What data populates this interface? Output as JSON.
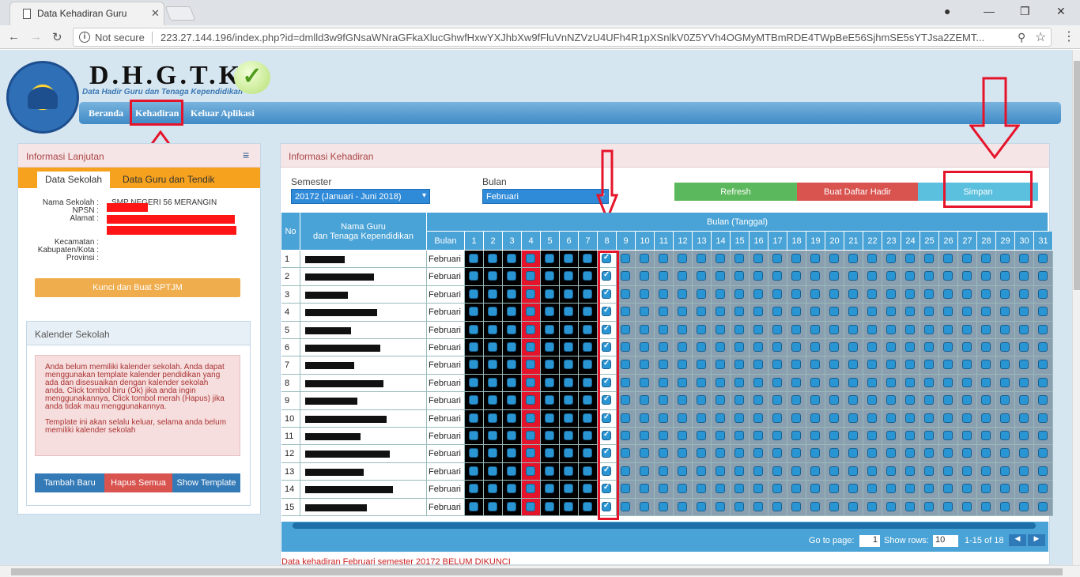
{
  "browser": {
    "tab_title": "Data Kehadiran Guru",
    "not_secure": "Not secure",
    "url": "223.27.144.196/index.php?id=dmlld3w9fGNsaWNraGFkaXlucGhwfHxwYXJhbXw9fFluVnNZVzU4UFh4R1pXSnlkV0Z5YVh4OGMyMTBmRDE4TWpBeE56SjhmSE5sYTJsa2ZEMT..."
  },
  "brand": {
    "title": "D.H.G.T.K",
    "tagline": "Data Hadir Guru dan Tenaga Kependidikan",
    "logo_text": "TUT WURI HANDAYANI"
  },
  "nav": {
    "home": "Beranda",
    "attendance": "Kehadiran",
    "exit": "Keluar Aplikasi"
  },
  "left_panel": {
    "title": "Informasi Lanjutan",
    "tabs": [
      "Data Sekolah",
      "Data Guru dan Tendik"
    ],
    "fields": {
      "name_label": "Nama Sekolah :",
      "name_value": "SMP NEGERI 56 MERANGIN",
      "npsn_label": "NPSN :",
      "address_label": "Alamat :",
      "kecamatan_label": "Kecamatan :",
      "kabupaten_label": "Kabupaten/Kota :",
      "provinsi_label": "Provinsi :"
    },
    "button": "Kunci dan Buat SPTJM"
  },
  "calendar": {
    "title": "Kalender Sekolah",
    "message": "Anda belum memiliki kalender sekolah. Anda dapat menggunakan template kalender pendidikan yang ada dan disesuaikan dengan kalender sekolah anda. Click tombol biru (Ok) jika anda ingin menggunakannya, Click tombol merah (Hapus) jika anda tidak mau menggunakannya.",
    "note": "Template ini akan selalu keluar, selama anda belum memiliki kalender sekolah",
    "buttons": [
      "Tambah Baru",
      "Hapus Semua",
      "Show Template"
    ]
  },
  "main": {
    "title": "Informasi Kehadiran",
    "semester_label": "Semester",
    "semester_value": "20172 (Januari - Juni 2018)",
    "month_label": "Bulan",
    "month_value": "Februari",
    "buttons": {
      "refresh": "Refresh",
      "create": "Buat Daftar Hadir",
      "save": "Simpan"
    },
    "headers": {
      "no": "No",
      "name": "Nama Guru\ndan Tenaga Kependidikan",
      "month": "Bulan",
      "group": "Bulan (Tanggal)"
    },
    "days": [
      "1",
      "2",
      "3",
      "4",
      "5",
      "6",
      "7",
      "8",
      "9",
      "10",
      "11",
      "12",
      "13",
      "14",
      "15",
      "16",
      "17",
      "18",
      "19",
      "20",
      "21",
      "22",
      "23",
      "24",
      "25",
      "26",
      "27",
      "28",
      "29",
      "30",
      "31"
    ],
    "rows": [
      "1",
      "2",
      "3",
      "4",
      "5",
      "6",
      "7",
      "8",
      "9",
      "10",
      "11",
      "12",
      "13",
      "14",
      "15"
    ],
    "row_month": "Februari",
    "pager": {
      "go_to": "Go to page:",
      "page": "1",
      "show_rows": "Show rows:",
      "rows_value": "10",
      "range": "1-15 of 18"
    },
    "footer_note": "Data kehadiran Februari semester 20172 BELUM DIKUNCI"
  },
  "colors": {
    "accent": "#4aa3d6",
    "highlight": "#e5142b",
    "refresh": "#5cb85c",
    "create": "#d9534f",
    "save": "#5bc0de"
  }
}
